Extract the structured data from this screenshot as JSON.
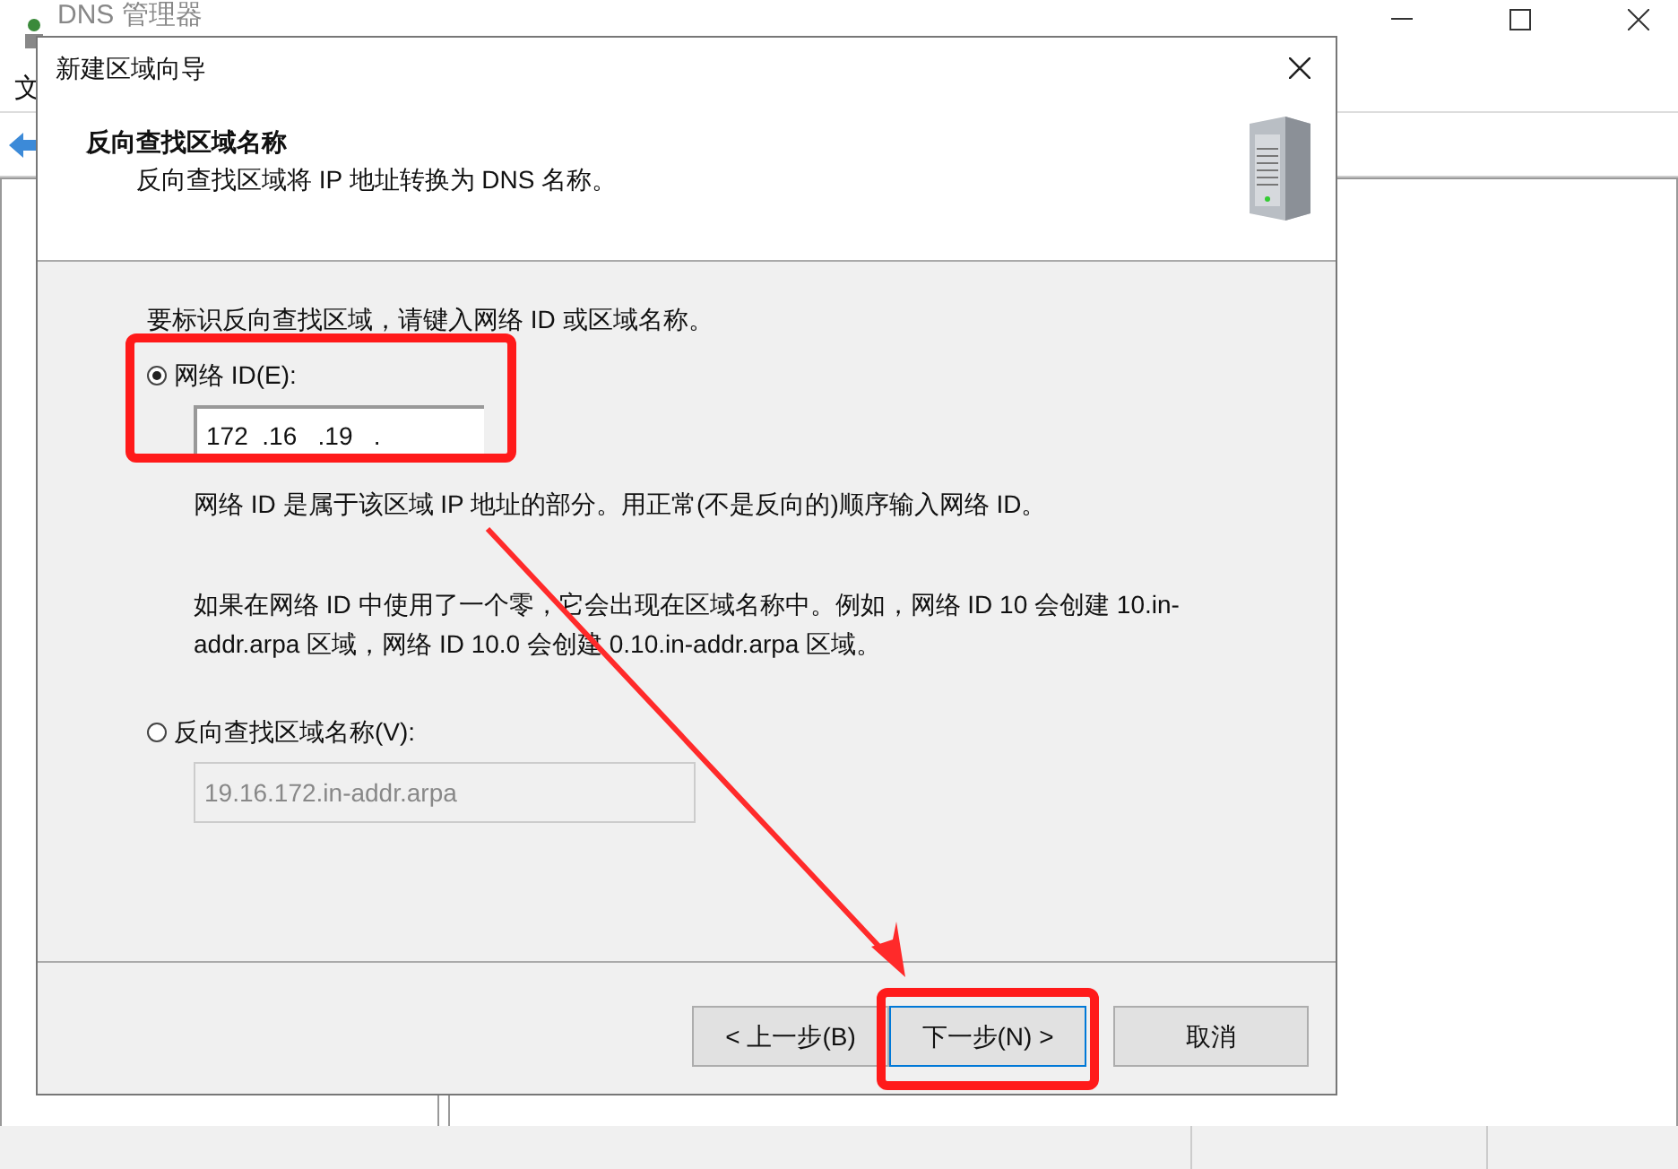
{
  "background_window": {
    "title": "DNS 管理器",
    "menu": [
      "文"
    ]
  },
  "dialog": {
    "title": "新建区域向导",
    "heading": "反向查找区域名称",
    "subheading": "反向查找区域将 IP 地址转换为 DNS 名称。",
    "prompt": "要标识反向查找区域，请键入网络 ID 或区域名称。",
    "options": [
      {
        "kind": "ip",
        "label": "网络 ID(E):",
        "selected": true,
        "value": "172  .16   .19   .",
        "disabled": false,
        "notes": [
          "网络 ID 是属于该区域 IP 地址的部分。用正常(不是反向的)顺序输入网络 ID。",
          "如果在网络 ID 中使用了一个零，它会出现在区域名称中。例如，网络 ID 10 会创建 10.in-addr.arpa 区域，网络 ID 10.0 会创建 0.10.in-addr.arpa 区域。"
        ]
      },
      {
        "kind": "name",
        "label": "反向查找区域名称(V):",
        "selected": false,
        "value": "19.16.172.in-addr.arpa",
        "disabled": true
      }
    ],
    "buttons": [
      {
        "label": "< 上一步(B)",
        "default": false
      },
      {
        "label": "下一步(N) >",
        "default": true
      },
      {
        "label": "取消",
        "default": false
      }
    ]
  }
}
